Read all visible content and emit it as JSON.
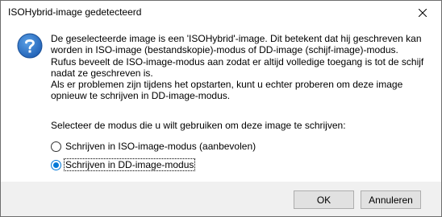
{
  "window": {
    "title": "ISOHybrid-image gedetecteerd",
    "close_icon": "close-icon"
  },
  "message": {
    "icon": "question-icon",
    "paragraph1": "De geselecteerde image is een 'ISOHybrid'-image. Dit betekent dat hij geschreven kan worden in ISO-image (bestandskopie)-modus of DD-image (schijf-image)-modus.",
    "paragraph2": "Rufus beveelt de ISO-image-modus aan zodat er altijd volledige toegang is tot de schijf nadat ze geschreven is.",
    "paragraph3": "Als er problemen zijn tijdens het opstarten, kunt u echter proberen om deze image opnieuw te schrijven in DD-image-modus.",
    "prompt": "Selecteer de modus die u wilt gebruiken om deze image te schrijven:"
  },
  "options": [
    {
      "label": "Schrijven in ISO-image-modus (aanbevolen)",
      "selected": false
    },
    {
      "label": "Schrijven in DD-image-modus",
      "selected": true
    }
  ],
  "buttons": {
    "ok": "OK",
    "cancel": "Annuleren"
  },
  "colors": {
    "accent": "#0078d7",
    "footer_bg": "#f0f0f0",
    "button_bg": "#e1e1e1"
  }
}
